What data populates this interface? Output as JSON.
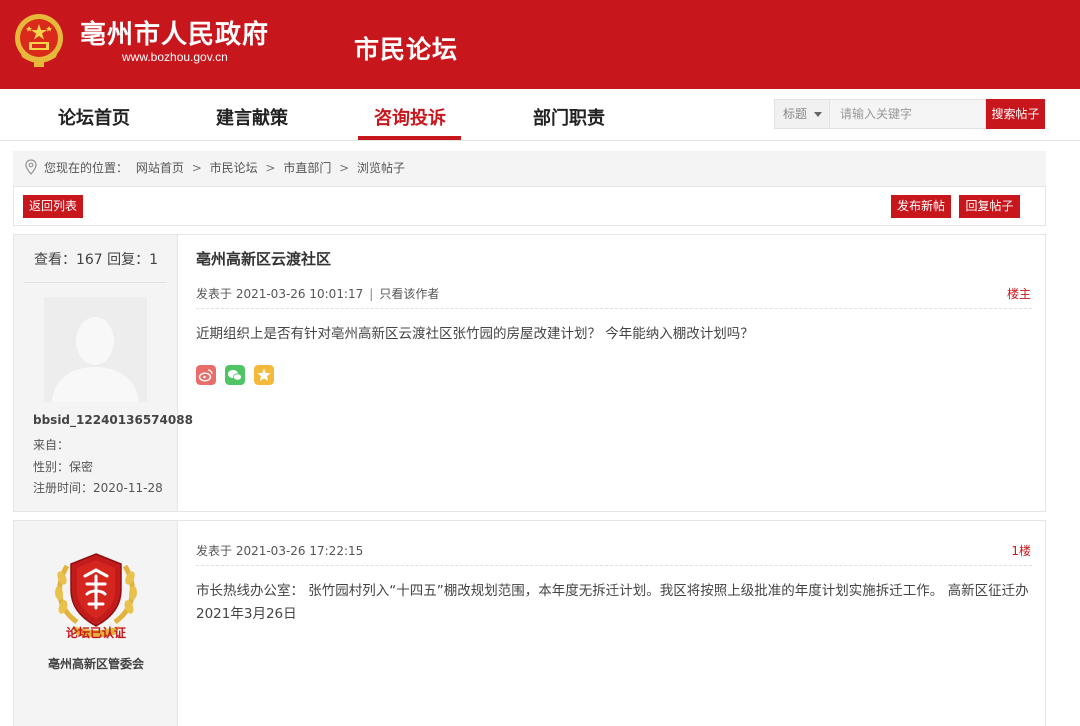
{
  "header": {
    "site_name": "亳州市人民政府",
    "site_url": "www.bozhou.gov.cn",
    "section_title": "市民论坛",
    "brand_color": "#c8161d"
  },
  "nav": {
    "items": [
      {
        "label": "论坛首页",
        "active": false
      },
      {
        "label": "建言献策",
        "active": false
      },
      {
        "label": "咨询投诉",
        "active": true
      },
      {
        "label": "部门职责",
        "active": false
      }
    ]
  },
  "search": {
    "select_value": "标题",
    "placeholder": "请输入关键字",
    "button_label": "搜索帖子"
  },
  "breadcrumb": {
    "prefix": "您现在的位置：",
    "items": [
      "网站首页",
      "市民论坛",
      "市直部门",
      "浏览帖子"
    ],
    "separator": ">"
  },
  "toolbar": {
    "back_label": "返回列表",
    "new_post_label": "发布新帖",
    "reply_label": "回复帖子"
  },
  "posts": [
    {
      "stats": "查看：167 回复：1",
      "author": "bbsid_12240136574088",
      "from_label": "来自：",
      "gender_label": "性别：保密",
      "registered_label": "注册时间：2020-11-28",
      "title": "亳州高新区云渡社区",
      "meta_date": "发表于 2021-03-26 10:01:17",
      "meta_pipe": "|",
      "only_author": "只看该作者",
      "floor": "楼主",
      "body": "近期组织上是否有针对亳州高新区云渡社区张竹园的房屋改建计划？ 今年能纳入棚改计划吗？",
      "share_icons": [
        "weibo-icon",
        "wechat-icon",
        "favorite-star-icon"
      ]
    },
    {
      "badge_text": "论坛已认证",
      "author": "亳州高新区管委会",
      "meta_date": "发表于 2021-03-26 17:22:15",
      "floor": "1楼",
      "body": "市长热线办公室： 张竹园村列入“十四五”棚改规划范围，本年度无拆迁计划。我区将按照上级批准的年度计划实施拆迁工作。 高新区征迁办 2021年3月26日"
    }
  ]
}
